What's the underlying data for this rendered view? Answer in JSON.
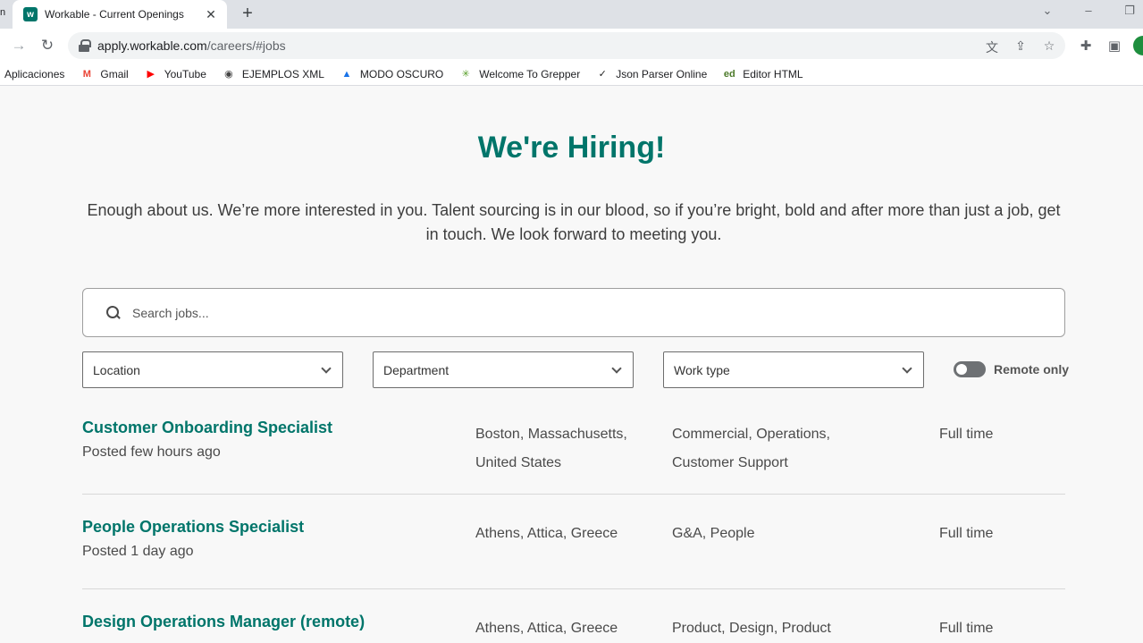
{
  "browser": {
    "tab_title": "Workable - Current Openings",
    "favicon_text": "w",
    "url_host": "apply.workable.com",
    "url_path": "/careers/#jobs",
    "bookmarks": [
      {
        "label": "Aplicaciones",
        "icon": "apps-grid-icon"
      },
      {
        "label": "Gmail",
        "icon": "gmail-icon",
        "glyph": "M",
        "color": "#ea4335"
      },
      {
        "label": "YouTube",
        "icon": "youtube-icon",
        "glyph": "▶",
        "color": "#ff0000"
      },
      {
        "label": "EJEMPLOS XML",
        "icon": "globe-icon",
        "glyph": "◉",
        "color": "#444444"
      },
      {
        "label": "MODO OSCURO",
        "icon": "flask-icon",
        "glyph": "▲",
        "color": "#1a73e8"
      },
      {
        "label": "Welcome To Grepper",
        "icon": "grepper-icon",
        "glyph": "✳",
        "color": "#5aa02c"
      },
      {
        "label": "Json Parser Online",
        "icon": "json-icon",
        "glyph": "✓",
        "color": "#222222"
      },
      {
        "label": "Editor HTML",
        "icon": "editor-html-icon",
        "glyph": "ed",
        "color": "#4c7a2a"
      }
    ]
  },
  "hero": {
    "title": "We're Hiring!",
    "text": "Enough about us. We’re more interested in you. Talent sourcing is in our blood, so if you’re bright, bold and after more than just a job, get in touch. We look forward to meeting you."
  },
  "search": {
    "placeholder": "Search jobs..."
  },
  "filters": {
    "location": "Location",
    "department": "Department",
    "work_type": "Work type",
    "remote_label": "Remote only",
    "remote_on": false
  },
  "jobs": [
    {
      "title": "Customer Onboarding Specialist",
      "posted": "Posted few hours ago",
      "location": "Boston, Massachusetts, United States",
      "department": "Commercial, Operations, Customer Support",
      "type": "Full time"
    },
    {
      "title": "People Operations Specialist",
      "posted": "Posted 1 day ago",
      "location": "Athens, Attica, Greece",
      "department": "G&A, People",
      "type": "Full time"
    },
    {
      "title": "Design Operations Manager (remote)",
      "posted": "",
      "location": "Athens, Attica, Greece",
      "department": "Product, Design, Product",
      "type": "Full time"
    }
  ],
  "colors": {
    "brand": "#00756a"
  }
}
